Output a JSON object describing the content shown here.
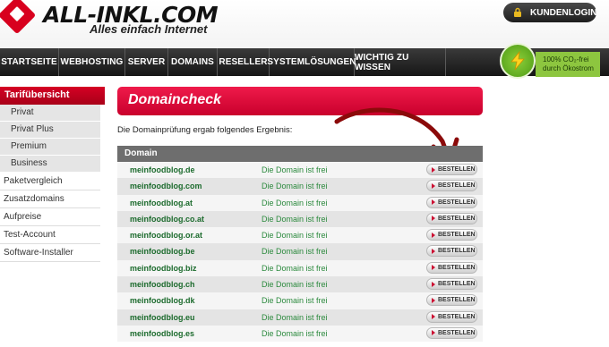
{
  "brand": {
    "name": "ALL-INKL.COM",
    "slogan": "Alles einfach Internet"
  },
  "header": {
    "login_label": "KUNDENLOGIN"
  },
  "nav": {
    "items": [
      {
        "label": "STARTSEITE"
      },
      {
        "label": "WEBHOSTING"
      },
      {
        "label": "SERVER"
      },
      {
        "label": "DOMAINS"
      },
      {
        "label": "RESELLER"
      },
      {
        "label": "SYSTEMLÖSUNGEN"
      },
      {
        "label": "WICHTIG ZU WISSEN"
      }
    ]
  },
  "eco_badge": {
    "text_line1": "100% CO₂-frei",
    "text_line2": "durch Ökostrom",
    "circle_text": "GREEN POWER"
  },
  "sidebar": {
    "heading": "Tarifübersicht",
    "subitems": [
      {
        "label": "Privat"
      },
      {
        "label": "Privat Plus"
      },
      {
        "label": "Premium"
      },
      {
        "label": "Business"
      }
    ],
    "links": [
      {
        "label": "Paketvergleich"
      },
      {
        "label": "Zusatzdomains"
      },
      {
        "label": "Aufpreise"
      },
      {
        "label": "Test-Account"
      },
      {
        "label": "Software-Installer"
      }
    ]
  },
  "main": {
    "title": "Domaincheck",
    "intro": "Die Domainprüfung ergab folgendes Ergebnis:",
    "table_header": "Domain",
    "order_label": "BESTELLEN",
    "rows": [
      {
        "domain": "meinfoodblog.de",
        "status": "Die Domain ist frei"
      },
      {
        "domain": "meinfoodblog.com",
        "status": "Die Domain ist frei"
      },
      {
        "domain": "meinfoodblog.at",
        "status": "Die Domain ist frei"
      },
      {
        "domain": "meinfoodblog.co.at",
        "status": "Die Domain ist frei"
      },
      {
        "domain": "meinfoodblog.or.at",
        "status": "Die Domain ist frei"
      },
      {
        "domain": "meinfoodblog.be",
        "status": "Die Domain ist frei"
      },
      {
        "domain": "meinfoodblog.biz",
        "status": "Die Domain ist frei"
      },
      {
        "domain": "meinfoodblog.ch",
        "status": "Die Domain ist frei"
      },
      {
        "domain": "meinfoodblog.dk",
        "status": "Die Domain ist frei"
      },
      {
        "domain": "meinfoodblog.eu",
        "status": "Die Domain ist frei"
      },
      {
        "domain": "meinfoodblog.es",
        "status": "Die Domain ist frei"
      }
    ]
  },
  "colors": {
    "brand_red": "#d8001e",
    "nav_bg": "#1e1e1e",
    "domain_green": "#1c6b2d",
    "eco_green": "#8dc63f",
    "arrow": "#8b0a0a"
  }
}
